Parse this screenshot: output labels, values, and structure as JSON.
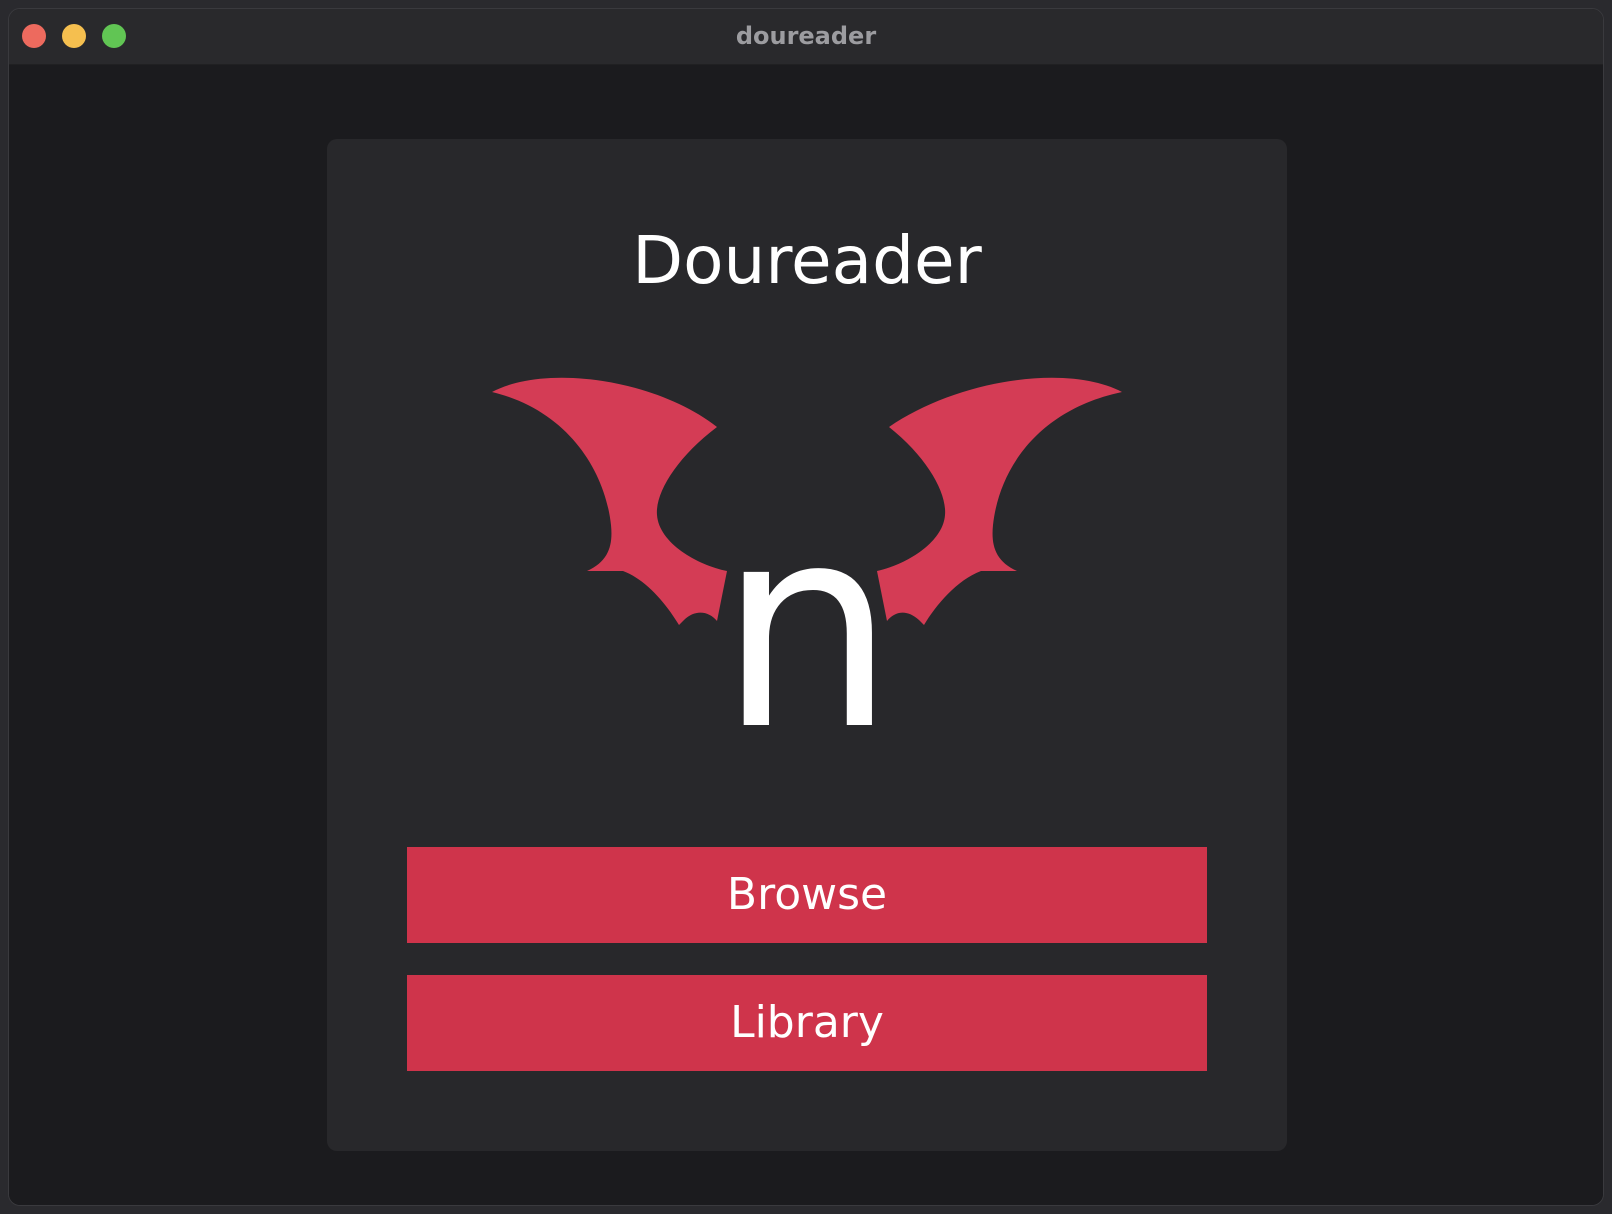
{
  "window": {
    "title": "doureader"
  },
  "main": {
    "app_title": "Doureader",
    "logo_letter": "n",
    "browse_label": "Browse",
    "library_label": "Library"
  },
  "colors": {
    "accent": "#cf344b",
    "wing": "#d43c55",
    "card_bg": "#28282b",
    "window_bg": "#1b1b1e"
  },
  "icons": {
    "logo": "bat-wings-logo-icon"
  }
}
